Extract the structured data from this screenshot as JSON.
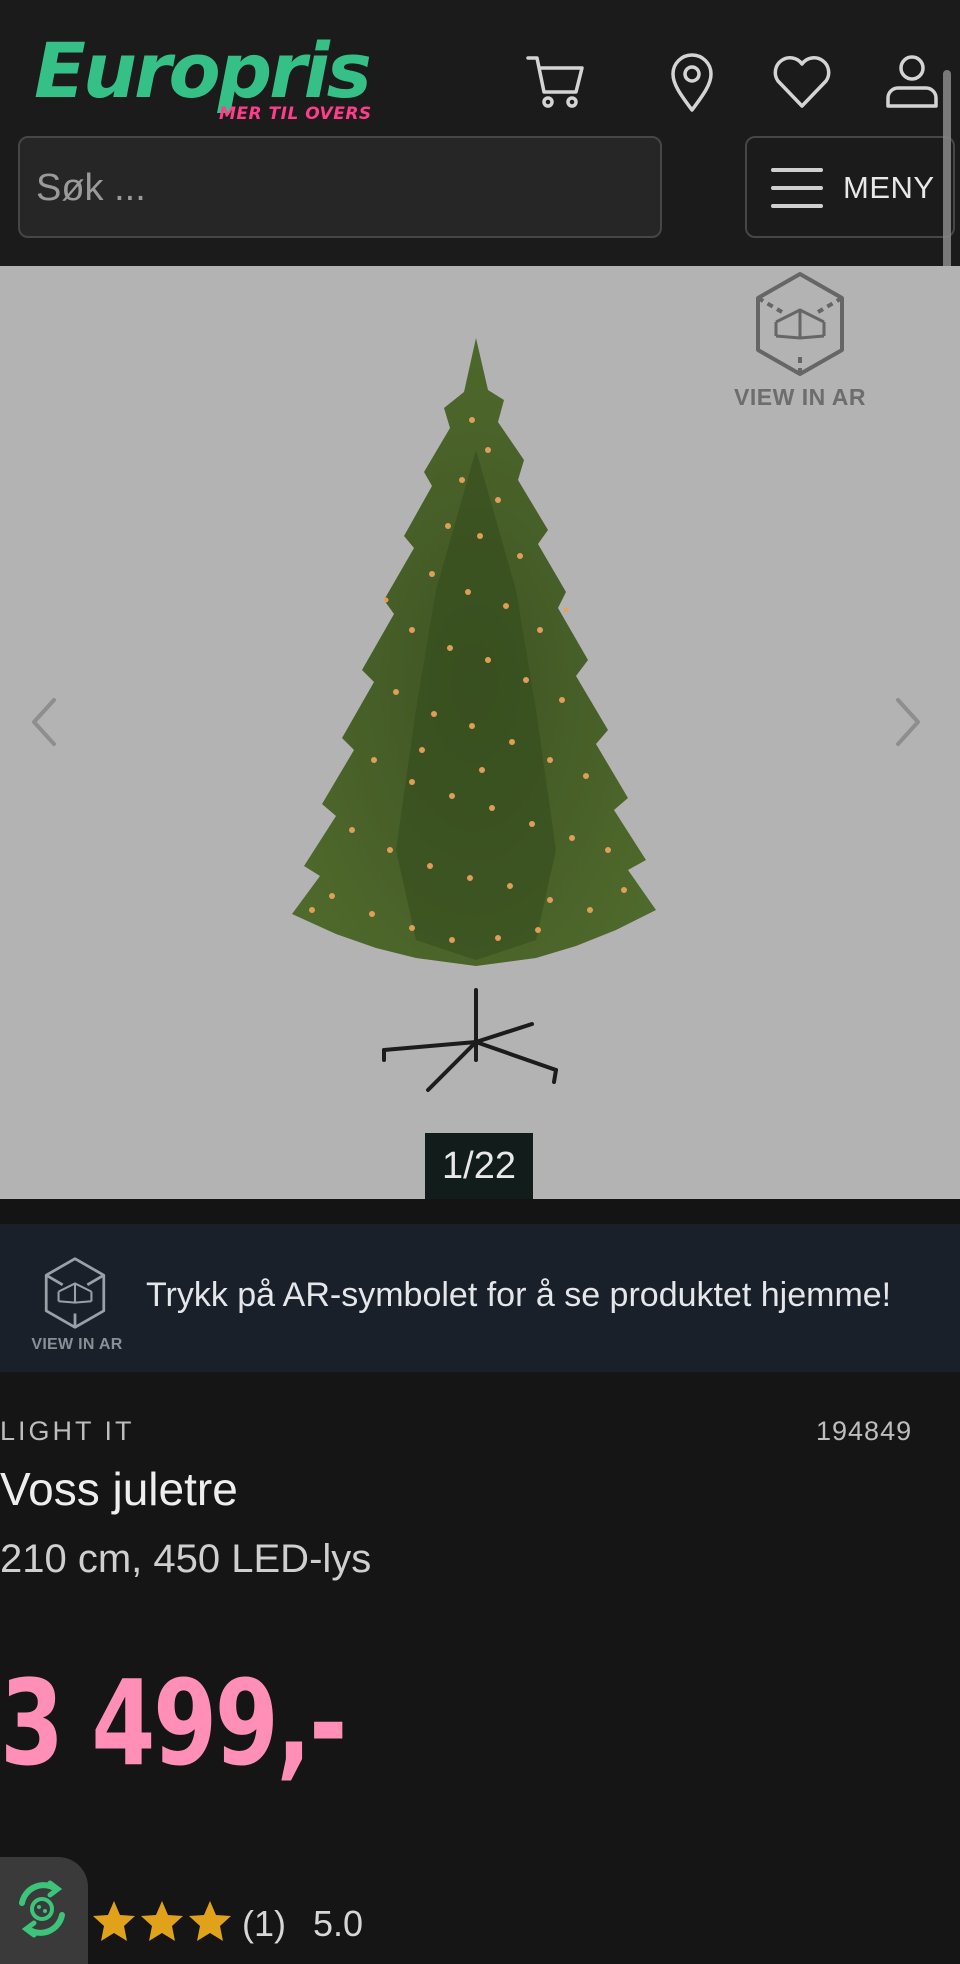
{
  "header": {
    "logo_text": "Europris",
    "logo_tagline": "MER TIL OVERS",
    "icons": [
      "cart-icon",
      "location-pin-icon",
      "heart-icon",
      "user-icon"
    ],
    "search_placeholder": "Søk ...",
    "menu_label": "MENY"
  },
  "gallery": {
    "ar_badge_label": "VIEW IN AR",
    "counter": "1/22",
    "current_image": 1,
    "total_images": 22
  },
  "ar_banner": {
    "badge_label": "VIEW IN AR",
    "message": "Trykk på AR-symbolet for å se produktet hjemme!"
  },
  "product": {
    "brand": "LIGHT IT",
    "sku": "194849",
    "title": "Voss juletre",
    "subtitle": "210 cm, 450 LED-lys",
    "price": "3 499,-"
  },
  "rating": {
    "stars_visible": 3,
    "count": "(1)",
    "score": "5.0"
  },
  "colors": {
    "brand_green": "#35c088",
    "brand_pink": "#ff3d8b",
    "price_pink": "#ff8fb6",
    "star_gold": "#e0a21b"
  }
}
